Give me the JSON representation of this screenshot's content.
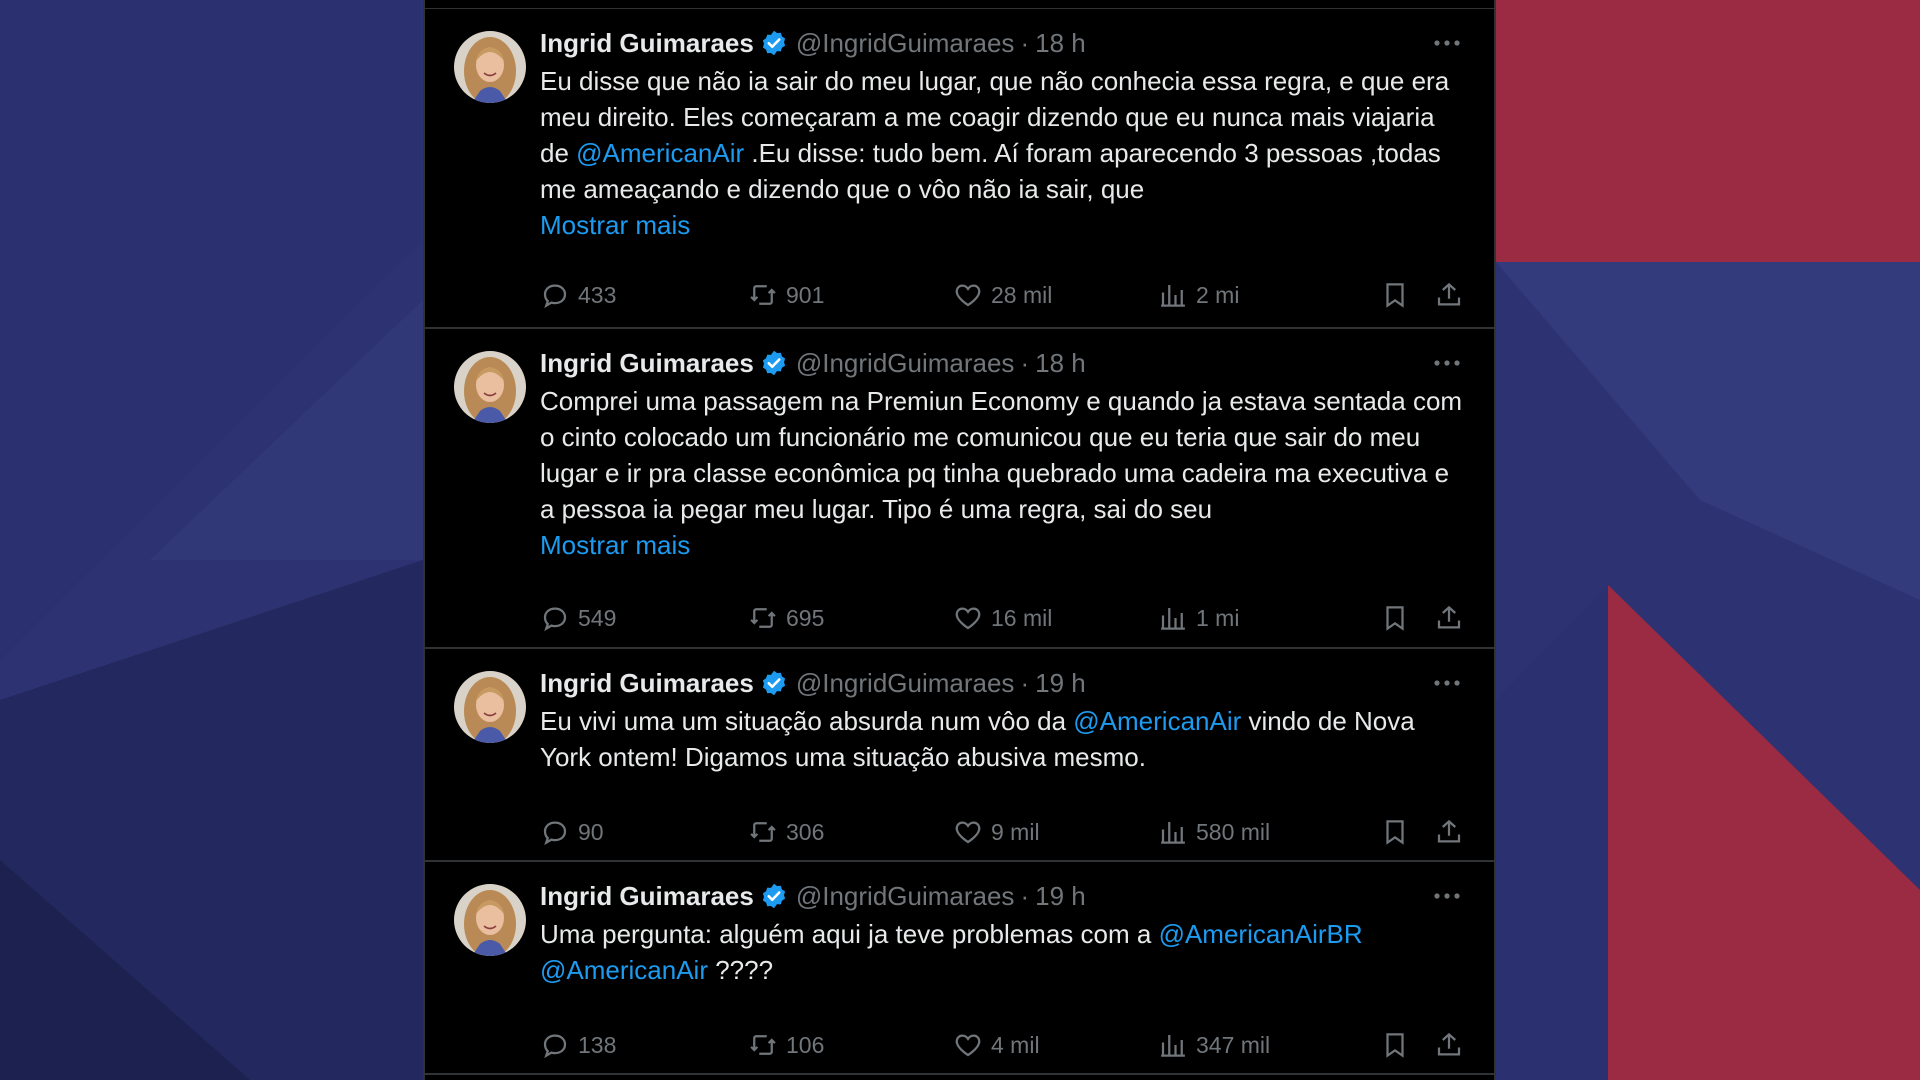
{
  "colors": {
    "background_navy": "#2b3170",
    "background_red": "#9b2a43",
    "feed_bg": "#000000",
    "text_primary": "#e7e9ea",
    "text_secondary": "#71767b",
    "link_blue": "#1d9bf0",
    "verified_blue": "#1d9bf0"
  },
  "tweets": [
    {
      "author": "Ingrid Guimaraes",
      "handle": "@IngridGuimaraes",
      "separator": "·",
      "time": "18 h",
      "segments": [
        {
          "type": "text",
          "value": "Eu disse que não ia sair do meu lugar, que não conhecia essa regra, e que era meu direito. Eles começaram a me coagir dizendo que eu nunca mais viajaria de "
        },
        {
          "type": "mention",
          "value": "@AmericanAir"
        },
        {
          "type": "text",
          "value": " .Eu disse: tudo bem. Aí foram aparecendo 3 pessoas ,todas me ameaçando e dizendo que o vôo não ia sair, que"
        }
      ],
      "show_more": "Mostrar mais",
      "replies": "433",
      "retweets": "901",
      "likes": "28 mil",
      "views": "2 mi"
    },
    {
      "author": "Ingrid Guimaraes",
      "handle": "@IngridGuimaraes",
      "separator": "·",
      "time": "18 h",
      "segments": [
        {
          "type": "text",
          "value": "Comprei uma passagem na Premiun Economy e quando ja estava sentada com o cinto colocado um funcionário me comunicou que eu teria que sair do meu lugar e ir pra classe econômica pq tinha quebrado uma cadeira ma executiva e a pessoa ia pegar meu lugar. Tipo é uma regra, sai do seu"
        }
      ],
      "show_more": "Mostrar mais",
      "replies": "549",
      "retweets": "695",
      "likes": "16 mil",
      "views": "1 mi"
    },
    {
      "author": "Ingrid Guimaraes",
      "handle": "@IngridGuimaraes",
      "separator": "·",
      "time": "19 h",
      "segments": [
        {
          "type": "text",
          "value": "Eu vivi uma um situação absurda num vôo da "
        },
        {
          "type": "mention",
          "value": "@AmericanAir"
        },
        {
          "type": "text",
          "value": " vindo de Nova York ontem! Digamos uma situação abusiva mesmo."
        }
      ],
      "show_more": "",
      "replies": "90",
      "retweets": "306",
      "likes": "9 mil",
      "views": "580 mil"
    },
    {
      "author": "Ingrid Guimaraes",
      "handle": "@IngridGuimaraes",
      "separator": "·",
      "time": "19 h",
      "segments": [
        {
          "type": "text",
          "value": "Uma pergunta: alguém aqui ja teve problemas com a "
        },
        {
          "type": "mention",
          "value": "@AmericanAirBR"
        },
        {
          "type": "text",
          "value": " "
        },
        {
          "type": "mention",
          "value": "@AmericanAir"
        },
        {
          "type": "text",
          "value": " ????"
        }
      ],
      "show_more": "",
      "replies": "138",
      "retweets": "106",
      "likes": "4 mil",
      "views": "347 mil"
    }
  ]
}
